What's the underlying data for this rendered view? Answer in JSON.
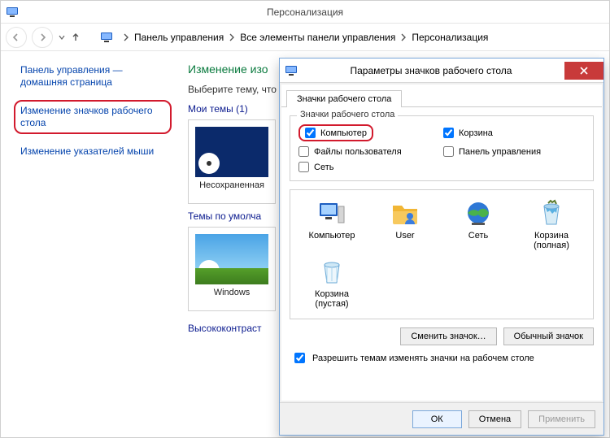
{
  "window": {
    "title": "Персонализация"
  },
  "breadcrumb": [
    "Панель управления",
    "Все элементы панели управления",
    "Персонализация"
  ],
  "sidebar": {
    "home_label": "Панель управления — домашняя страница",
    "link_desktop_icons": "Изменение значков рабочего стола",
    "link_mouse_pointers": "Изменение указателей мыши"
  },
  "main": {
    "heading_partial": "Изменение изо",
    "subheading_partial": "Выберите тему, что",
    "my_themes_label": "Мои темы (1)",
    "theme_unsaved": "Несохраненная",
    "default_themes_label": "Темы по умолча",
    "theme_windows": "Windows",
    "high_contrast_label": "Высококонтраст"
  },
  "dialog": {
    "title": "Параметры значков рабочего стола",
    "tab": "Значки рабочего стола",
    "group_legend": "Значки рабочего стола",
    "checks": {
      "computer": {
        "label": "Компьютер",
        "checked": true
      },
      "user_files": {
        "label": "Файлы пользователя",
        "checked": false
      },
      "network": {
        "label": "Сеть",
        "checked": false
      },
      "recycle": {
        "label": "Корзина",
        "checked": true
      },
      "control_panel": {
        "label": "Панель управления",
        "checked": false
      }
    },
    "icons": {
      "computer": "Компьютер",
      "user": "User",
      "network": "Сеть",
      "recycle_full": "Корзина\n(полная)",
      "recycle_empty": "Корзина\n(пустая)"
    },
    "change_icon": "Сменить значок…",
    "default_icon": "Обычный значок",
    "allow_themes": {
      "label": "Разрешить темам изменять значки на рабочем столе",
      "checked": true
    },
    "ok": "ОК",
    "cancel": "Отмена",
    "apply": "Применить"
  }
}
